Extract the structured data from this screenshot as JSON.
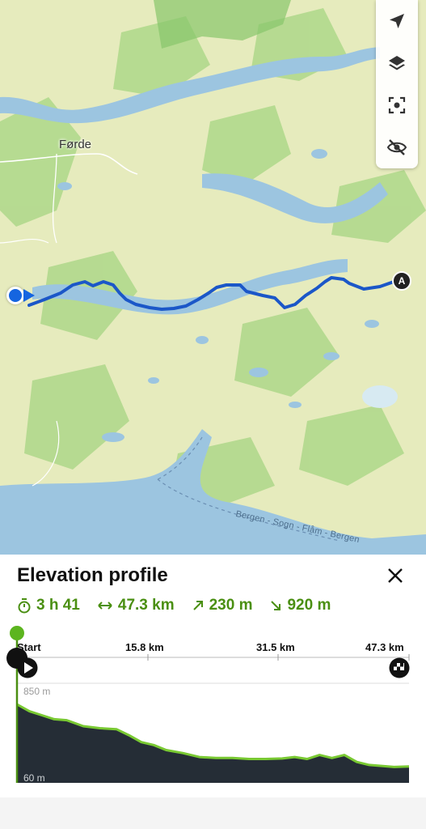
{
  "map": {
    "place_label": "Førde",
    "road_label": "Bergen - Sogn - Flåm - Bergen",
    "start_marker_label": "A",
    "controls": [
      {
        "icon": "navigate-arrow-icon",
        "label": "Navigate"
      },
      {
        "icon": "layers-icon",
        "label": "Map layers"
      },
      {
        "icon": "focus-center-icon",
        "label": "Center map"
      },
      {
        "icon": "eye-off-icon",
        "label": "Hide"
      }
    ],
    "colors": {
      "route": "#1b57c8",
      "water": "#9cc5e0",
      "land": "#e6ebbd",
      "forest": "#9fd07a"
    }
  },
  "elevation_panel": {
    "title": "Elevation profile",
    "stats": {
      "duration": "3 h 41",
      "distance": "47.3 km",
      "ascent": "230 m",
      "descent": "920 m"
    },
    "axis_labels": [
      "Start",
      "15.8 km",
      "31.5 km",
      "47.3 km"
    ],
    "colors": {
      "accent": "#4a8f12",
      "fill": "#252d36",
      "line": "#79c932"
    }
  },
  "chart_data": {
    "type": "area",
    "title": "Elevation profile",
    "xlabel": "",
    "ylabel": "",
    "x_unit": "km",
    "y_unit": "m",
    "xlim": [
      0,
      47.3
    ],
    "ylim": [
      60,
      850
    ],
    "x_ticks": [
      "Start",
      "15.8 km",
      "31.5 km",
      "47.3 km"
    ],
    "y_ticks": [
      "850 m",
      "60 m"
    ],
    "x": [
      0,
      1.5,
      3.0,
      4.5,
      6.0,
      8.0,
      10.0,
      12.0,
      13.5,
      15.0,
      16.5,
      18.0,
      20.0,
      22.0,
      24.0,
      26.0,
      28.0,
      30.0,
      32.0,
      33.5,
      35.0,
      36.5,
      38.0,
      39.5,
      41.0,
      42.5,
      44.0,
      45.5,
      47.3
    ],
    "y": [
      850,
      780,
      740,
      700,
      690,
      630,
      610,
      600,
      540,
      470,
      440,
      390,
      360,
      320,
      310,
      310,
      300,
      300,
      305,
      320,
      300,
      340,
      310,
      340,
      270,
      240,
      230,
      220,
      225
    ]
  }
}
